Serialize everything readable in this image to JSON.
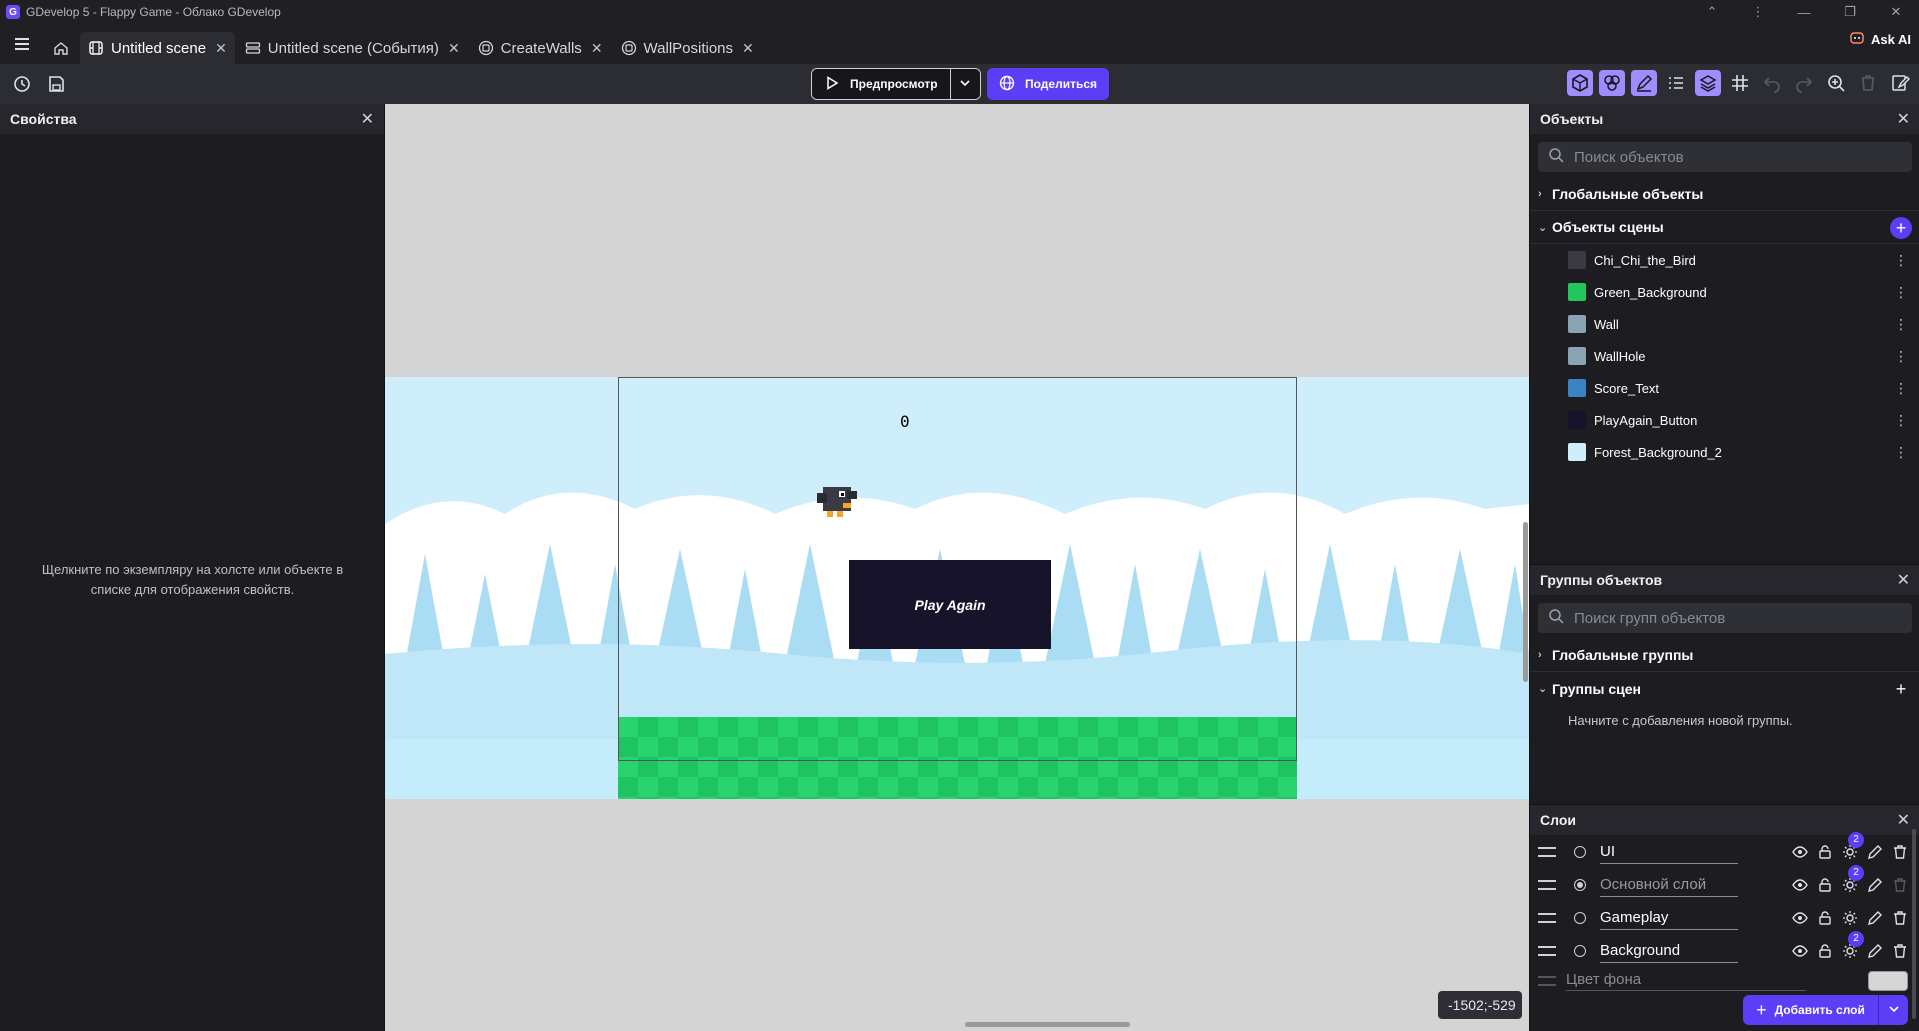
{
  "window": {
    "title": "GDevelop 5 - Flappy Game - Облако GDevelop",
    "logo_letter": "G"
  },
  "tabs": [
    {
      "label": "Untitled scene",
      "active": true
    },
    {
      "label": "Untitled scene (События)"
    },
    {
      "label": "CreateWalls"
    },
    {
      "label": "WallPositions"
    }
  ],
  "ask_ai": "Ask AI",
  "toolbar": {
    "preview_label": "Предпросмотр",
    "share_label": "Поделиться"
  },
  "properties": {
    "title": "Свойства",
    "hint": "Щелкните по экземпляру на холсте или объекте в списке для отображения свойств."
  },
  "canvas": {
    "score": "0",
    "play_again": "Play Again",
    "coords": "-1502;-529"
  },
  "objects": {
    "title": "Объекты",
    "search_placeholder": "Поиск объектов",
    "global_section": "Глобальные объекты",
    "scene_section": "Объекты сцены",
    "items": [
      {
        "name": "Chi_Chi_the_Bird",
        "thumb_color": "#3a3a44"
      },
      {
        "name": "Green_Background",
        "thumb_color": "#22c55e"
      },
      {
        "name": "Wall",
        "thumb_color": "#8aa4b4"
      },
      {
        "name": "WallHole",
        "thumb_color": "#8aa4b4"
      },
      {
        "name": "Score_Text",
        "thumb_color": "#3b82c4"
      },
      {
        "name": "PlayAgain_Button",
        "thumb_color": "#17132a"
      },
      {
        "name": "Forest_Background_2",
        "thumb_color": "#cfeefb"
      }
    ]
  },
  "groups": {
    "title": "Группы объектов",
    "search_placeholder": "Поиск групп объектов",
    "global_section": "Глобальные группы",
    "scene_section": "Группы сцен",
    "empty_hint": "Начните с добавления новой группы."
  },
  "layers": {
    "title": "Слои",
    "items": [
      {
        "name": "UI",
        "selected": false,
        "effects": "2",
        "muted": false
      },
      {
        "name": "Основной слой",
        "selected": true,
        "effects": "2",
        "muted": true
      },
      {
        "name": "Gameplay",
        "selected": false,
        "effects": "",
        "muted": false
      },
      {
        "name": "Background",
        "selected": false,
        "effects": "2",
        "muted": false
      }
    ],
    "bg_color_label": "Цвет фона",
    "bg_color": "#d6d6d6",
    "add_layer_label": "Добавить слой"
  },
  "colors": {
    "accent": "#5b3ef5",
    "panel": "#1c1c21",
    "toolbar": "#2c2c33"
  }
}
